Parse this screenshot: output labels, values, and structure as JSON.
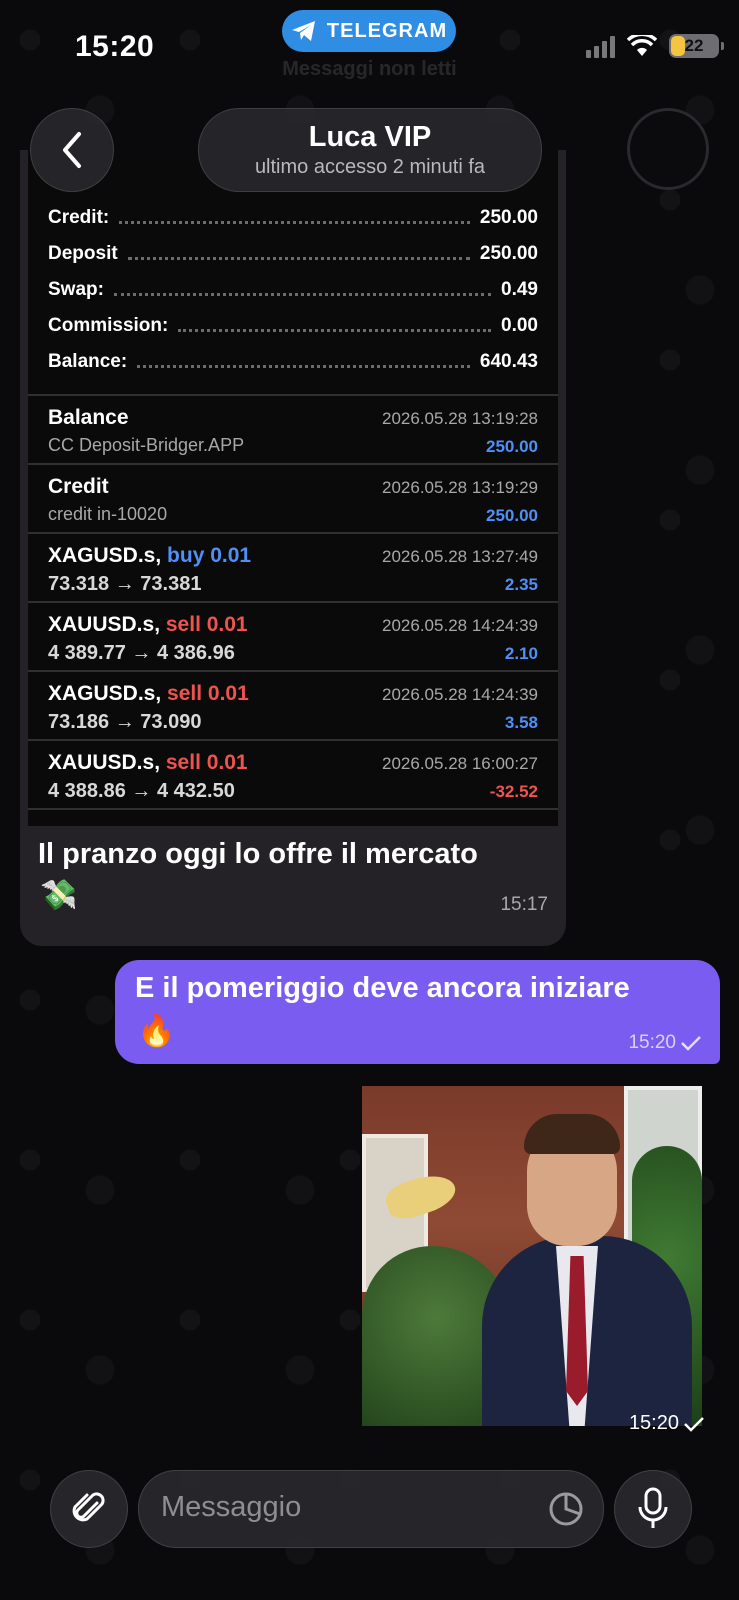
{
  "status_bar": {
    "time": "15:20",
    "source_app": "TELEGRAM",
    "battery": "22"
  },
  "background_title": "Messaggi non letti",
  "header": {
    "name": "Luca VIP",
    "status": "ultimo accesso 2 minuti fa"
  },
  "report": {
    "summary": [
      {
        "label": "Credit:",
        "value": "250.00"
      },
      {
        "label": "Deposit",
        "value": "250.00"
      },
      {
        "label": "Swap:",
        "value": "0.49"
      },
      {
        "label": "Commission:",
        "value": "0.00"
      },
      {
        "label": "Balance:",
        "value": "640.43"
      }
    ],
    "entries": [
      {
        "title": "Balance",
        "side": "",
        "detail": "CC Deposit-Bridger.APP",
        "datetime": "2026.05.28 13:19:28",
        "amount": "250.00",
        "sign": "pos"
      },
      {
        "title": "Credit",
        "side": "",
        "detail": "credit in-10020",
        "datetime": "2026.05.28 13:19:29",
        "amount": "250.00",
        "sign": "pos"
      },
      {
        "title": "XAGUSD.s,",
        "side": "buy 0.01",
        "detail": "73.318 → 73.381",
        "datetime": "2026.05.28 13:27:49",
        "amount": "2.35",
        "sign": "pos"
      },
      {
        "title": "XAUUSD.s,",
        "side": "sell 0.01",
        "detail": "4 389.77 → 4 386.96",
        "datetime": "2026.05.28 14:24:39",
        "amount": "2.10",
        "sign": "pos"
      },
      {
        "title": "XAGUSD.s,",
        "side": "sell 0.01",
        "detail": "73.186 → 73.090",
        "datetime": "2026.05.28 14:24:39",
        "amount": "3.58",
        "sign": "pos"
      },
      {
        "title": "XAUUSD.s,",
        "side": "sell 0.01",
        "detail": "4 388.86 → 4 432.50",
        "datetime": "2026.05.28 16:00:27",
        "amount": "-32.52",
        "sign": "neg"
      }
    ]
  },
  "messages": {
    "incoming": {
      "text": "Il pranzo oggi lo offre il mercato",
      "emoji": "💸",
      "time": "15:17"
    },
    "outgoing": {
      "text": "E il pomeriggio deve ancora iniziare",
      "emoji": "🔥",
      "time": "15:20"
    },
    "gif": {
      "time": "15:20"
    }
  },
  "input": {
    "placeholder": "Messaggio"
  },
  "colors": {
    "accent": "#7b5cf0",
    "telegram_blue": "#2f8de4",
    "buy": "#4f8ff7",
    "sell": "#ef5350"
  }
}
